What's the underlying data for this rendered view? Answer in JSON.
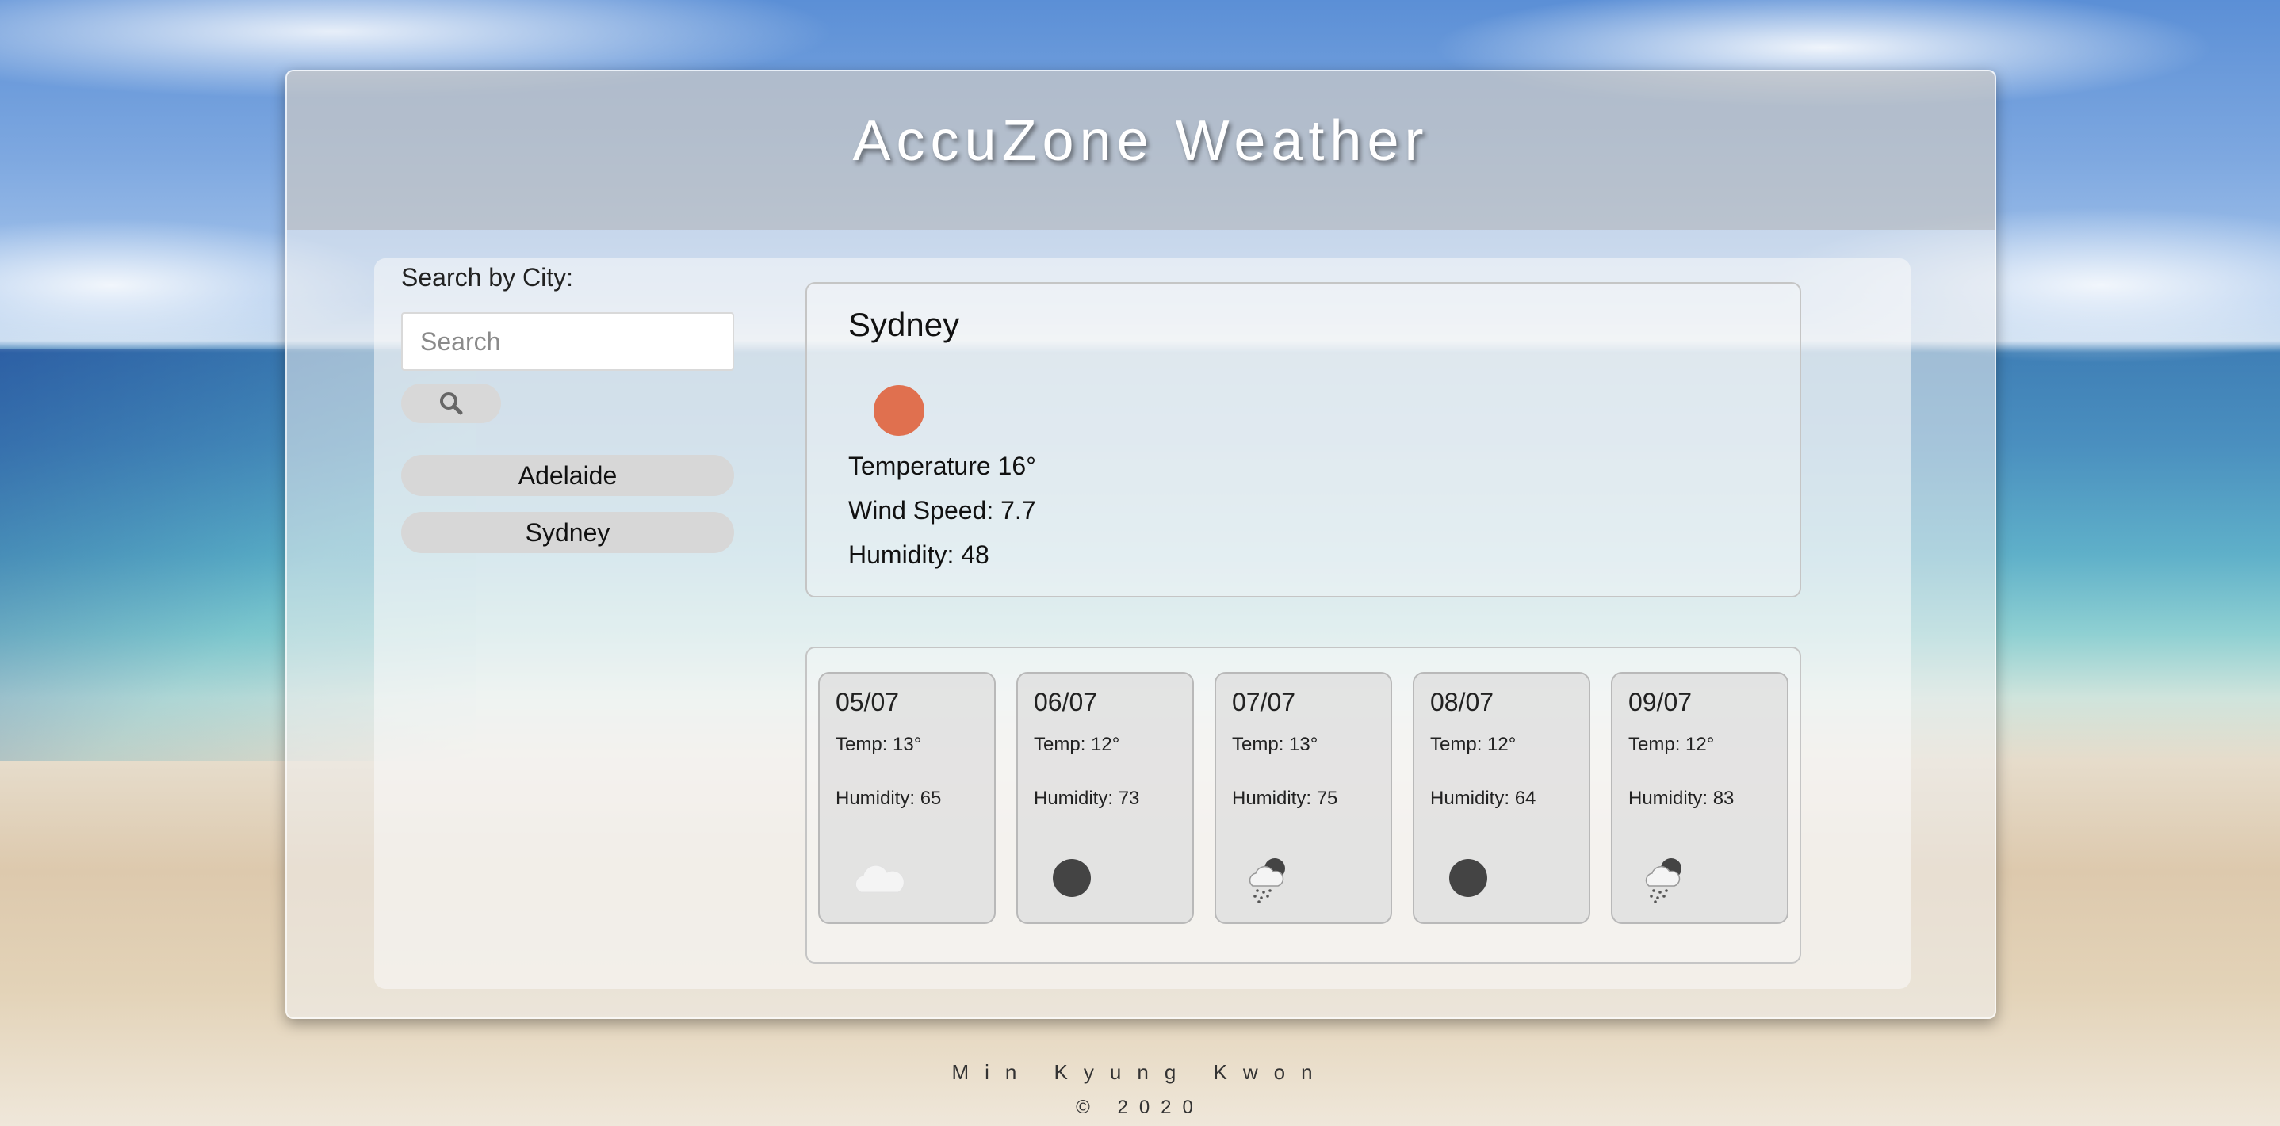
{
  "app": {
    "title": "AccuZone Weather"
  },
  "search": {
    "label": "Search by City:",
    "placeholder": "Search",
    "value": ""
  },
  "history": [
    {
      "label": "Adelaide"
    },
    {
      "label": "Sydney"
    }
  ],
  "current": {
    "city": "Sydney",
    "icon": "sun-icon",
    "icon_color": "#e0704f",
    "temperature": "Temperature 16°",
    "wind": "Wind Speed: 7.7",
    "humidity": "Humidity: 48"
  },
  "forecast": [
    {
      "date": "05/07",
      "temp": "Temp: 13°",
      "humidity": "Humidity: 65",
      "icon": "cloud-icon"
    },
    {
      "date": "06/07",
      "temp": "Temp: 12°",
      "humidity": "Humidity: 73",
      "icon": "moon-icon"
    },
    {
      "date": "07/07",
      "temp": "Temp: 13°",
      "humidity": "Humidity: 75",
      "icon": "rain-cloud-icon"
    },
    {
      "date": "08/07",
      "temp": "Temp: 12°",
      "humidity": "Humidity: 64",
      "icon": "moon-icon"
    },
    {
      "date": "09/07",
      "temp": "Temp: 12°",
      "humidity": "Humidity: 83",
      "icon": "rain-cloud-icon"
    }
  ],
  "footer": {
    "name": "Min Kyung Kwon",
    "copyright": "© 2020"
  }
}
